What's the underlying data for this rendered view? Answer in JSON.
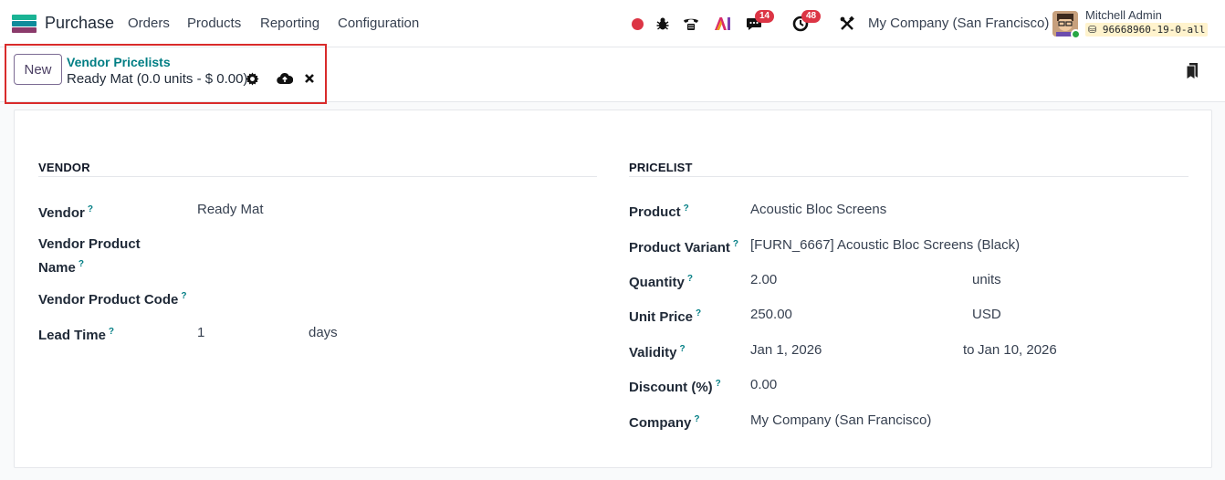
{
  "navbar": {
    "app_name": "Purchase",
    "menu": [
      "Orders",
      "Products",
      "Reporting",
      "Configuration"
    ],
    "discuss_count": "14",
    "activity_count": "48",
    "company": "My Company (San Francisco)",
    "user_name": "Mitchell Admin",
    "database": "96668960-19-0-all",
    "app_icon_colors": [
      "#1ab394",
      "#0f8b9b",
      "#8b3a6b"
    ]
  },
  "control_panel": {
    "new_label": "New",
    "breadcrumb": "Vendor Pricelists",
    "record_title": "Ready Mat (0.0 units - $ 0.00)",
    "highlight_color": "#d92b2b"
  },
  "vendor_section": {
    "title": "VENDOR",
    "fields": {
      "vendor_label": "Vendor",
      "vendor_value": "Ready Mat",
      "vendor_product_name_label_1": "Vendor Product",
      "vendor_product_name_label_2": "Name",
      "vendor_product_code_label": "Vendor Product Code",
      "lead_time_label": "Lead Time",
      "lead_time_value": "1",
      "lead_time_unit": "days"
    }
  },
  "pricelist_section": {
    "title": "PRICELIST",
    "fields": {
      "product_label": "Product",
      "product_value": "Acoustic Bloc Screens",
      "variant_label": "Product Variant",
      "variant_value": "[FURN_6667] Acoustic Bloc Screens (Black)",
      "quantity_label": "Quantity",
      "quantity_value": "2.00",
      "quantity_unit": "units",
      "unit_price_label": "Unit Price",
      "unit_price_value": "250.00",
      "currency": "USD",
      "validity_label": "Validity",
      "validity_from": "Jan 1, 2026",
      "validity_to_label": "to",
      "validity_to": "Jan 10, 2026",
      "discount_label": "Discount (%)",
      "discount_value": "0.00",
      "company_label": "Company",
      "company_value": "My Company (San Francisco)"
    }
  },
  "help_mark": "?",
  "colors": {
    "accent_teal": "#017e84",
    "primary_purple": "#7b6b93",
    "badge_red": "#dc3545"
  }
}
